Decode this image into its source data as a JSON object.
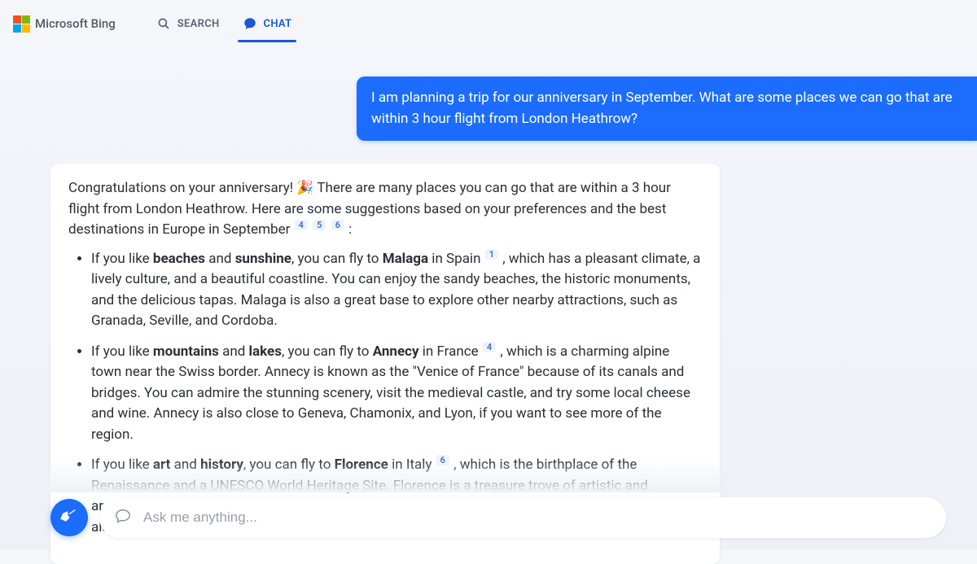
{
  "header": {
    "brand": "Microsoft Bing",
    "tabs": {
      "search": "SEARCH",
      "chat": "CHAT"
    }
  },
  "conversation": {
    "user_message": "I am planning a trip for our anniversary in September. What are some places we can go that are within 3 hour flight from London Heathrow?",
    "assistant": {
      "intro_prefix": "Congratulations on your anniversary! 🎉 There are many places you can go that are within a 3 hour flight from London Heathrow. Here are some suggestions based on your preferences and the best destinations in Europe in September ",
      "intro_citations": [
        "4",
        "5",
        "6"
      ],
      "intro_suffix": " :",
      "items": [
        {
          "pre": "If you like ",
          "bold1": "beaches",
          "mid1": " and ",
          "bold2": "sunshine",
          "mid2": ", you can fly to ",
          "bold3": "Malaga",
          "post1": " in Spain ",
          "citation": "1",
          "post2": " , which has a pleasant climate, a lively culture, and a beautiful coastline. You can enjoy the sandy beaches, the historic monuments, and the delicious tapas. Malaga is also a great base to explore other nearby attractions, such as Granada, Seville, and Cordoba."
        },
        {
          "pre": "If you like ",
          "bold1": "mountains",
          "mid1": " and ",
          "bold2": "lakes",
          "mid2": ", you can fly to ",
          "bold3": "Annecy",
          "post1": " in France ",
          "citation": "4",
          "post2": " , which is a charming alpine town near the Swiss border. Annecy is known as the \"Venice of France\" because of its canals and bridges. You can admire the stunning scenery, visit the medieval castle, and try some local cheese and wine. Annecy is also close to Geneva, Chamonix, and Lyon, if you want to see more of the region."
        },
        {
          "pre": "If you like ",
          "bold1": "art",
          "mid1": " and ",
          "bold2": "history",
          "mid2": ", you can fly to ",
          "bold3": "Florence",
          "post1": " in Italy ",
          "citation": "6",
          "post2": " , which is the birthplace of the Renaissance and a UNESCO World Heritage Site. Florence is a treasure trove of artistic and architectural masterpieces, such as the Duomo, the Uffizi Gallery, and the Ponte Vecchio. You can also explore the Tuscan countryside, taste the famous gelato, and shop for leather goods."
        }
      ]
    }
  },
  "input": {
    "placeholder": "Ask me anything..."
  }
}
